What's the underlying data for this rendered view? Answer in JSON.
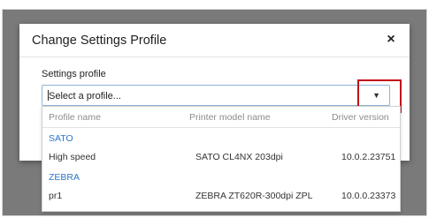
{
  "dialog": {
    "title": "Change Settings Profile",
    "close_label": "×"
  },
  "settings_profile": {
    "label": "Settings profile",
    "placeholder": "Select a profile...",
    "arrow": "▼"
  },
  "dropdown": {
    "columns": {
      "name": "Profile name",
      "model": "Printer model name",
      "driver": "Driver version"
    },
    "groups": [
      {
        "name": "SATO",
        "items": [
          {
            "name": "High speed",
            "model": "SATO CL4NX 203dpi",
            "driver": "10.0.2.23751"
          }
        ]
      },
      {
        "name": "ZEBRA",
        "items": [
          {
            "name": "pr1",
            "model": "ZEBRA ZT620R-300dpi ZPL",
            "driver": "10.0.0.23373"
          }
        ]
      }
    ]
  },
  "colors": {
    "group_link": "#2a78c8",
    "highlight": "#c0111b",
    "backdrop": "#7a7a7a"
  }
}
